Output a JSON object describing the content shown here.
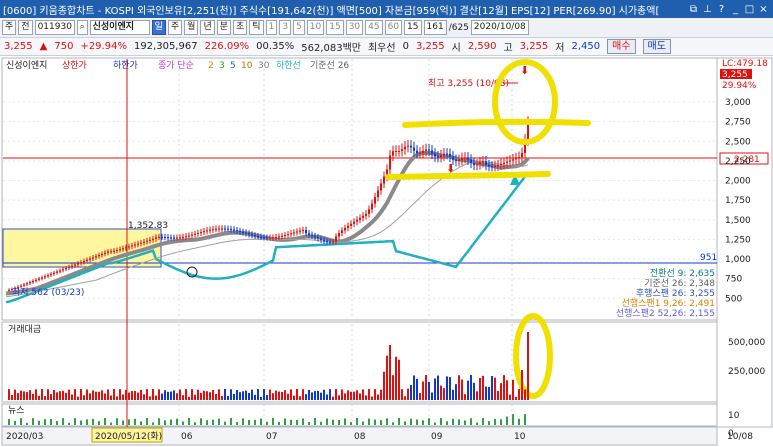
{
  "window": {
    "title": "[0600] 키움종합차트 - KOSPI 외국인보유[2,251(천)] 주식수[191,642(천)] 액면[500] 자본금[959(억)] 결산[12월] EPS[12] PER[269.90] 시가총액[",
    "icons": [
      "menu-icon",
      "copy-icon",
      "chart-icon",
      "pin-icon",
      "help-icon",
      "minimize-icon",
      "maximize-icon",
      "close-icon"
    ]
  },
  "toolbar": {
    "period_select": "주",
    "all_label": "전",
    "stock_code": "011930",
    "stock_name": "신성이엔지",
    "interval_active": "일",
    "intervals": [
      "주",
      "월",
      "년",
      "분",
      "초",
      "틱"
    ],
    "minute_buttons": [
      "1",
      "3",
      "5",
      "10",
      "15",
      "30",
      "45",
      "60"
    ],
    "count": "15",
    "page_indicator": "161",
    "page_total": "/625",
    "date": "2020/10/08"
  },
  "quote": {
    "price": "3,255",
    "change": "750",
    "change_rate": "+29.94%",
    "volume": "192,305,967",
    "vol_rate": "226.09%",
    "turnover": "00.35%",
    "amount": "562,083백만",
    "preferred": "최우선",
    "zero": "0",
    "price2": "3,255",
    "open_label": "시",
    "open_value": "2,590",
    "high_label": "고",
    "high_value": "3,255",
    "low_label": "저",
    "low_value": "2,450",
    "buy_button": "매수",
    "sell_button": "매도"
  },
  "legend": {
    "stock": "신성이엔지",
    "upper": "상한가",
    "lower": "하한가",
    "simple": "종가 단순",
    "ma1": "2",
    "ma2": "3",
    "ma3": "5",
    "ma4": "10",
    "ma5": "30",
    "lowline": "하한선",
    "baseline": "기준선 26"
  },
  "annotations": {
    "high_label": "최고 3,255 (10/08)",
    "low_label": "최저 562 (03/23)",
    "box_value": "1,352.83",
    "level_951": "951",
    "lc_label": "LC:479.18",
    "lc_price": "3,255",
    "lc_rate": "29.94%",
    "level_2281": "2,281"
  },
  "ichimoku": [
    {
      "text": "전환선 9: 2,635",
      "color": "#008080"
    },
    {
      "text": "기준선 26: 2,348",
      "color": "#606060"
    },
    {
      "text": "후행스팬 26: 3,255",
      "color": "#3050c0"
    },
    {
      "text": "선행스팬1 9,26: 2,491",
      "color": "#e08000"
    },
    {
      "text": "선행스팬2 52,26: 2,155",
      "color": "#6060e0"
    }
  ],
  "panels": {
    "volume": "거래대금",
    "news": "뉴스",
    "vol_500k": "500,000",
    "vol_250k": "250,000",
    "news_10": "10",
    "news_0": "0"
  },
  "price_axis": [
    "3,000",
    "2,750",
    "2,500",
    "2,250",
    "2,000",
    "1,750",
    "1,500",
    "1,250",
    "1,000",
    "750",
    "500"
  ],
  "x_axis": {
    "labels": [
      "2020/03",
      "06",
      "07",
      "08",
      "09",
      "10"
    ],
    "cursor_date": "2020/05/12(화)",
    "end_date": "10/08"
  },
  "colors": {
    "up": "#e01010",
    "down": "#1038d0",
    "teal": "#20b0c0",
    "gray_ma": "#808080",
    "highlight": "#f0e000",
    "box": "#fff7a0"
  }
}
